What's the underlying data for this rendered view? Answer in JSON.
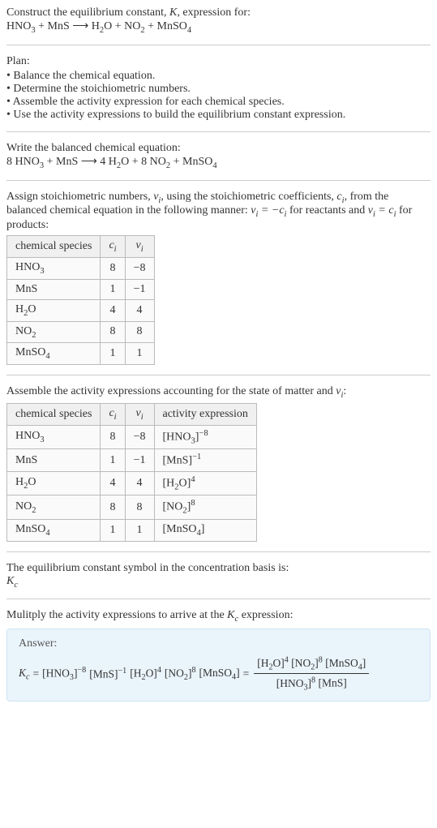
{
  "header": {
    "title_prefix": "Construct the equilibrium constant, ",
    "title_k": "K",
    "title_suffix": ", expression for:",
    "equation": "HNO_3 + MnS ⟶ H_2O + NO_2 + MnSO_4"
  },
  "plan": {
    "label": "Plan:",
    "items": [
      "Balance the chemical equation.",
      "Determine the stoichiometric numbers.",
      "Assemble the activity expression for each chemical species.",
      "Use the activity expressions to build the equilibrium constant expression."
    ]
  },
  "balanced": {
    "label": "Write the balanced chemical equation:",
    "equation": "8 HNO_3 + MnS ⟶ 4 H_2O + 8 NO_2 + MnSO_4"
  },
  "stoich": {
    "text_a": "Assign stoichiometric numbers, ",
    "nu": "ν_i",
    "text_b": ", using the stoichiometric coefficients, ",
    "ci": "c_i",
    "text_c": ", from the balanced chemical equation in the following manner: ",
    "rel1": "ν_i = −c_i",
    "text_d": " for reactants and ",
    "rel2": "ν_i = c_i",
    "text_e": " for products:",
    "headers": {
      "species": "chemical species",
      "ci": "c_i",
      "nu": "ν_i"
    },
    "rows": [
      {
        "species": "HNO_3",
        "ci": "8",
        "nu": "−8"
      },
      {
        "species": "MnS",
        "ci": "1",
        "nu": "−1"
      },
      {
        "species": "H_2O",
        "ci": "4",
        "nu": "4"
      },
      {
        "species": "NO_2",
        "ci": "8",
        "nu": "8"
      },
      {
        "species": "MnSO_4",
        "ci": "1",
        "nu": "1"
      }
    ]
  },
  "activity": {
    "label_a": "Assemble the activity expressions accounting for the state of matter and ",
    "nu": "ν_i",
    "label_b": ":",
    "headers": {
      "species": "chemical species",
      "ci": "c_i",
      "nu": "ν_i",
      "act": "activity expression"
    },
    "rows": [
      {
        "species": "HNO_3",
        "ci": "8",
        "nu": "−8",
        "base": "[HNO_3]",
        "exp": "−8"
      },
      {
        "species": "MnS",
        "ci": "1",
        "nu": "−1",
        "base": "[MnS]",
        "exp": "−1"
      },
      {
        "species": "H_2O",
        "ci": "4",
        "nu": "4",
        "base": "[H_2O]",
        "exp": "4"
      },
      {
        "species": "NO_2",
        "ci": "8",
        "nu": "8",
        "base": "[NO_2]",
        "exp": "8"
      },
      {
        "species": "MnSO_4",
        "ci": "1",
        "nu": "1",
        "base": "[MnSO_4]",
        "exp": ""
      }
    ]
  },
  "symbol": {
    "line1": "The equilibrium constant symbol in the concentration basis is:",
    "kc": "K_c"
  },
  "multiply": {
    "label_a": "Mulitply the activity expressions to arrive at the ",
    "kc": "K_c",
    "label_b": " expression:"
  },
  "answer": {
    "label": "Answer:",
    "kc": "K_c",
    "eq": " = ",
    "terms": [
      {
        "base": "[HNO_3]",
        "exp": "−8"
      },
      {
        "base": "[MnS]",
        "exp": "−1"
      },
      {
        "base": "[H_2O]",
        "exp": "4"
      },
      {
        "base": "[NO_2]",
        "exp": "8"
      },
      {
        "base": "[MnSO_4]",
        "exp": ""
      }
    ],
    "eq2": " = ",
    "frac_num": [
      {
        "base": "[H_2O]",
        "exp": "4"
      },
      {
        "base": "[NO_2]",
        "exp": "8"
      },
      {
        "base": "[MnSO_4]",
        "exp": ""
      }
    ],
    "frac_den": [
      {
        "base": "[HNO_3]",
        "exp": "8"
      },
      {
        "base": "[MnS]",
        "exp": ""
      }
    ]
  },
  "chart_data": {
    "type": "table",
    "title": "Stoichiometric numbers and activity expressions",
    "rows": [
      {
        "species": "HNO3",
        "c_i": 8,
        "nu_i": -8,
        "activity": "[HNO3]^-8"
      },
      {
        "species": "MnS",
        "c_i": 1,
        "nu_i": -1,
        "activity": "[MnS]^-1"
      },
      {
        "species": "H2O",
        "c_i": 4,
        "nu_i": 4,
        "activity": "[H2O]^4"
      },
      {
        "species": "NO2",
        "c_i": 8,
        "nu_i": 8,
        "activity": "[NO2]^8"
      },
      {
        "species": "MnSO4",
        "c_i": 1,
        "nu_i": 1,
        "activity": "[MnSO4]"
      }
    ]
  }
}
